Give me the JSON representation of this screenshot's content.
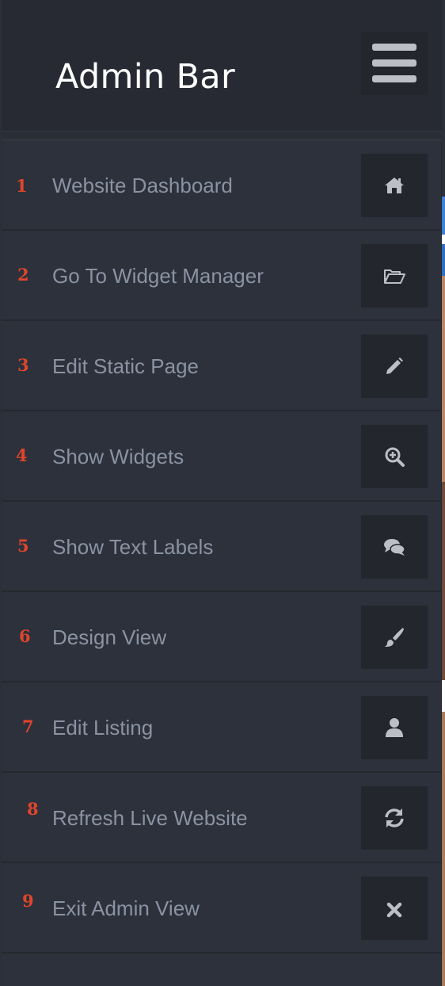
{
  "header": {
    "title": "Admin Bar",
    "toggle_icon": "hamburger-menu-icon"
  },
  "menu": {
    "items": [
      {
        "number": "1",
        "label": "Website Dashboard",
        "icon": "home-icon"
      },
      {
        "number": "2",
        "label": "Go To Widget Manager",
        "icon": "folder-open-icon"
      },
      {
        "number": "3",
        "label": "Edit Static Page",
        "icon": "pencil-icon"
      },
      {
        "number": "4",
        "label": "Show Widgets",
        "icon": "zoom-in-icon"
      },
      {
        "number": "5",
        "label": "Show Text Labels",
        "icon": "comments-icon"
      },
      {
        "number": "6",
        "label": "Design View",
        "icon": "paint-brush-icon"
      },
      {
        "number": "7",
        "label": "Edit Listing",
        "icon": "user-icon"
      },
      {
        "number": "8",
        "label": "Refresh Live Website",
        "icon": "refresh-icon"
      },
      {
        "number": "9",
        "label": "Exit Admin View",
        "icon": "close-icon"
      }
    ]
  },
  "colors": {
    "panel_bg": "#2d313b",
    "header_bg": "#272a32",
    "icon_box_bg": "#23262d",
    "label_text": "#8a93a3",
    "number_text": "#e0452c",
    "title_text": "#ffffff",
    "icon_fill": "#bcc0c6"
  }
}
